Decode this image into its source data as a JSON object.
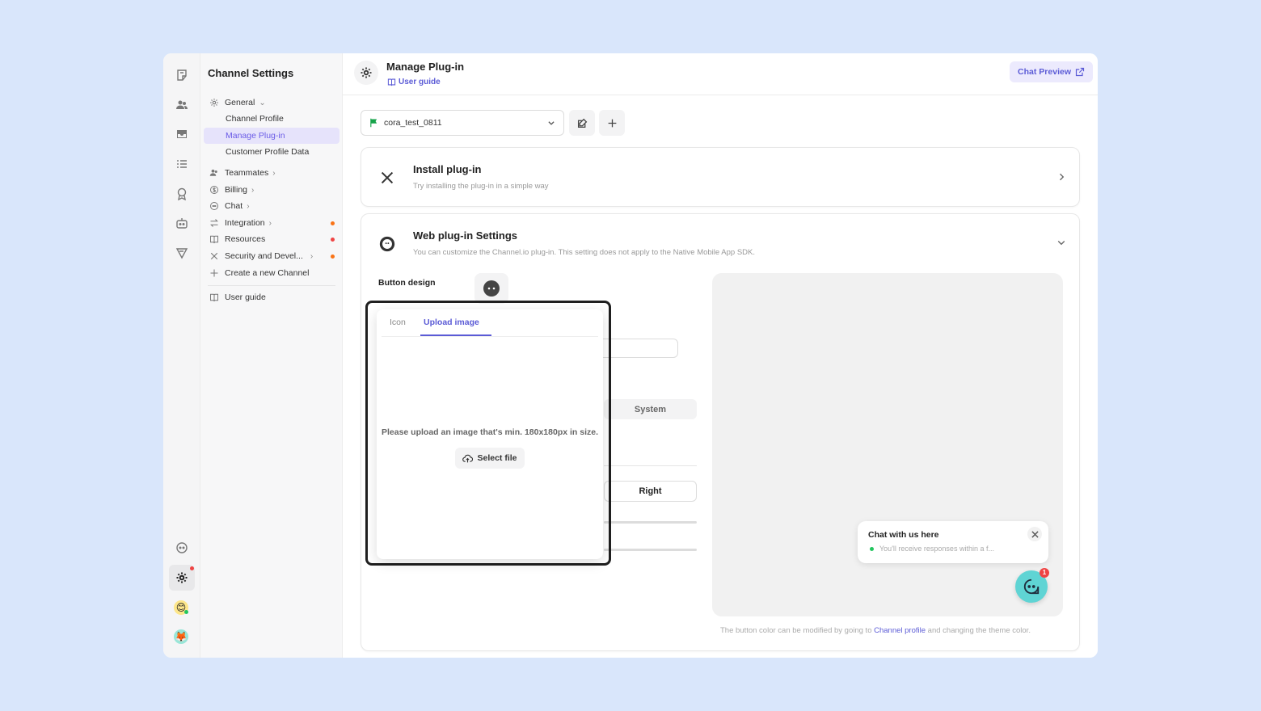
{
  "sidebar": {
    "title": "Channel Settings",
    "items": [
      {
        "label": "General",
        "icon": "gear-icon"
      },
      {
        "label": "Channel Profile"
      },
      {
        "label": "Manage Plug-in"
      },
      {
        "label": "Customer Profile Data"
      },
      {
        "label": "Teammates",
        "icon": "users-icon"
      },
      {
        "label": "Billing",
        "icon": "dollar-icon"
      },
      {
        "label": "Chat",
        "icon": "chat-icon"
      },
      {
        "label": "Integration",
        "icon": "arrows-icon"
      },
      {
        "label": "Resources",
        "icon": "book-icon"
      },
      {
        "label": "Security and Devel...",
        "icon": "tools-icon"
      },
      {
        "label": "Create a new Channel",
        "icon": "plus-icon"
      },
      {
        "label": "User guide",
        "icon": "book-icon"
      }
    ]
  },
  "header": {
    "title": "Manage Plug-in",
    "user_guide": "User guide",
    "chat_preview": "Chat Preview"
  },
  "plugin_selector": {
    "value": "cora_test_0811"
  },
  "install_card": {
    "title": "Install plug-in",
    "subtitle": "Try installing the plug-in in a simple way"
  },
  "web_card": {
    "title": "Web plug-in Settings",
    "subtitle": "You can customize the Channel.io plug-in. This setting does not apply to the Native Mobile App SDK.",
    "button_design_label": "Button design",
    "theme_option": "System",
    "position_option": "Right",
    "footnote_prefix": "The button color can be modified by going to ",
    "footnote_link": "Channel profile",
    "footnote_suffix": " and changing the theme color."
  },
  "preview": {
    "bubble_title": "Chat with us here",
    "bubble_sub": "You'll receive responses within a f...",
    "badge_count": "1",
    "accent": "#5fd4d4"
  },
  "popover": {
    "tab_icon": "Icon",
    "tab_upload": "Upload image",
    "hint": "Please upload an image that's min. 180x180px in size.",
    "select_file": "Select file"
  },
  "colors": {
    "accent": "#5b5bd6",
    "background": "#d9e6fb"
  }
}
